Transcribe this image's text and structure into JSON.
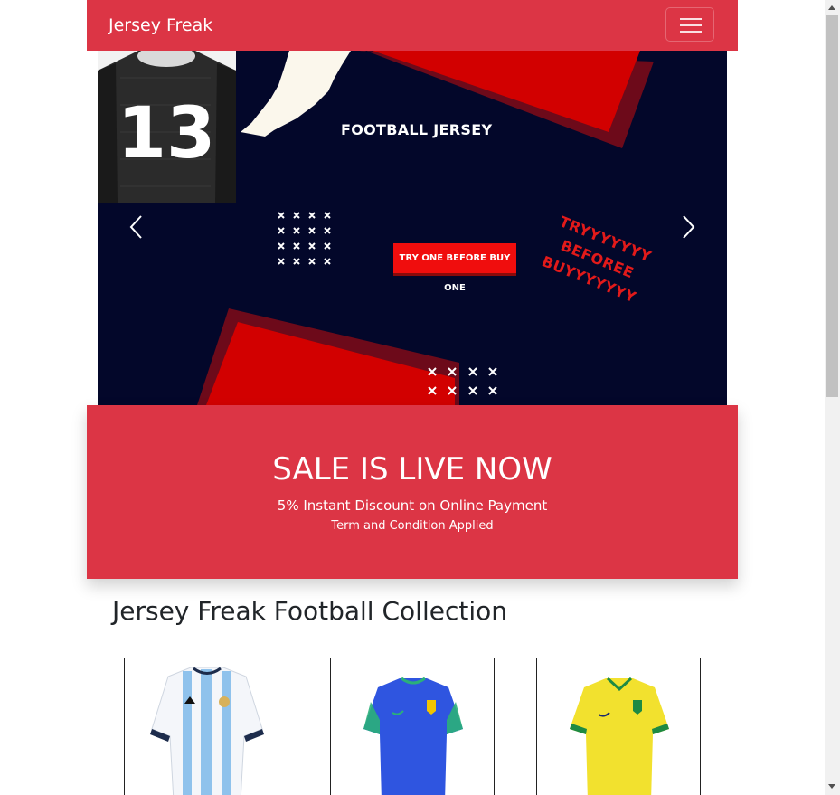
{
  "navbar": {
    "brand": "Jersey Freak",
    "toggler_icon": "hamburger-menu-icon"
  },
  "carousel": {
    "title": "FOOTBALL JERSEY",
    "jersey_number": "13",
    "button_label": "TRY ONE BEFORE BUY ONE",
    "slogan": "TRYYYYYYY\nBEFOREE\nBUYYYYYYY",
    "prev_icon": "chevron-left-icon",
    "next_icon": "chevron-right-icon"
  },
  "sale": {
    "title": "SALE IS LIVE NOW",
    "subtitle": "5% Instant Discount on Online Payment",
    "terms": "Term and Condition Applied"
  },
  "collection": {
    "title": "Jersey Freak Football Collection",
    "products": [
      {
        "name": "argentina-jersey-icon"
      },
      {
        "name": "brazil-away-jersey-icon"
      },
      {
        "name": "brazil-home-jersey-icon"
      }
    ]
  },
  "colors": {
    "brand_red": "#dc3545",
    "banner_navy": "#03072a"
  }
}
